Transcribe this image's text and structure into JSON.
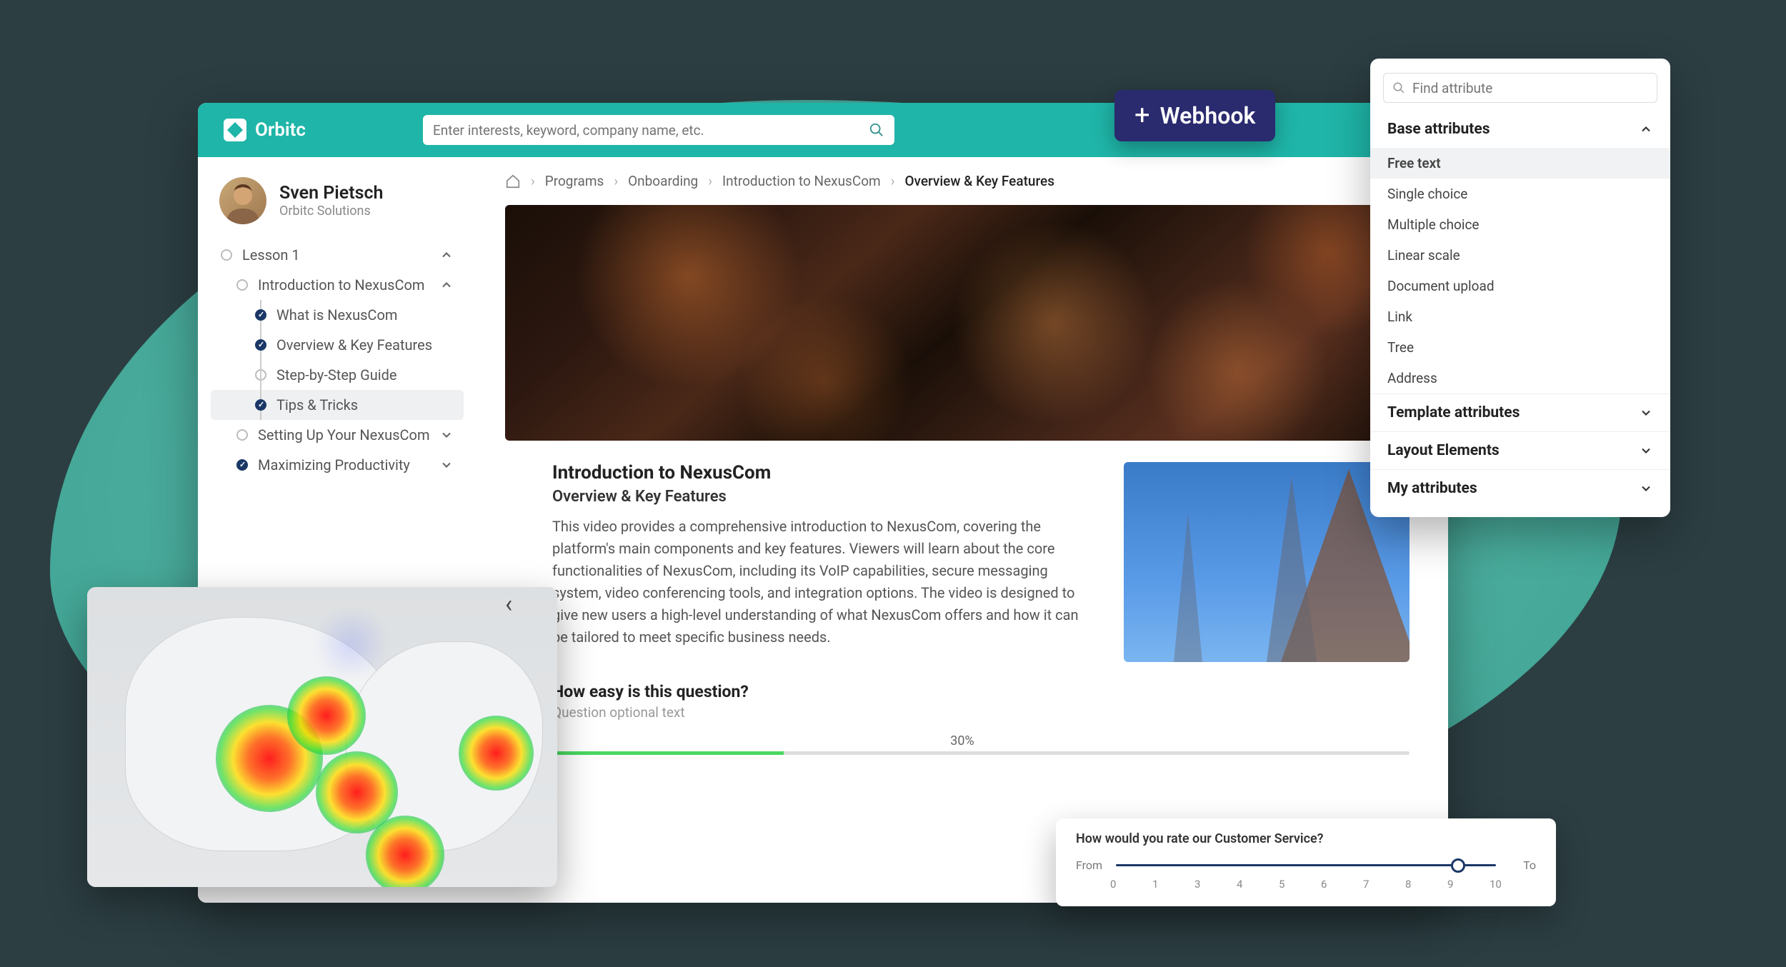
{
  "brand": {
    "name": "Orbitc"
  },
  "search": {
    "placeholder": "Enter interests, keyword, company name, etc."
  },
  "user": {
    "name": "Sven Pietsch",
    "org": "Orbitc Solutions"
  },
  "nav": {
    "lesson": "Lesson 1",
    "intro": "Introduction to NexusCom",
    "items": [
      "What is NexusCom",
      "Overview & Key Features",
      "Step-by-Step Guide",
      "Tips & Tricks"
    ],
    "setup": "Setting Up Your NexusCom",
    "max": "Maximizing Productivity"
  },
  "breadcrumb": [
    "Programs",
    "Onboarding",
    "Introduction to NexusCom",
    "Overview & Key Features"
  ],
  "article": {
    "title": "Introduction to NexusCom",
    "subtitle": "Overview & Key Features",
    "body": "This video provides a comprehensive introduction to NexusCom, covering the platform's main components and key features. Viewers will learn about the core functionalities of NexusCom, including its VoIP capabilities, secure messaging system, video conferencing tools, and integration options. The video is designed to give new users a high-level understanding of what NexusCom offers and how it can be tailored to meet specific business needs."
  },
  "question": {
    "title": "How easy is this question?",
    "subtitle": "Question optional text"
  },
  "progress": {
    "percent": "30%",
    "value": 30
  },
  "webhook": {
    "label": "Webhook"
  },
  "attributes": {
    "search_placeholder": "Find attribute",
    "sections": {
      "base": "Base attributes",
      "template": "Template attributes",
      "layout": "Layout Elements",
      "my": "My attributes"
    },
    "base_items": [
      "Free text",
      "Single choice",
      "Multiple choice",
      "Linear scale",
      "Document upload",
      "Link",
      "Tree",
      "Address"
    ]
  },
  "slider": {
    "question": "How would you rate our Customer Service?",
    "from": "From",
    "to": "To",
    "ticks": [
      "0",
      "1",
      "3",
      "4",
      "5",
      "6",
      "7",
      "8",
      "9",
      "10"
    ],
    "value": 9
  }
}
